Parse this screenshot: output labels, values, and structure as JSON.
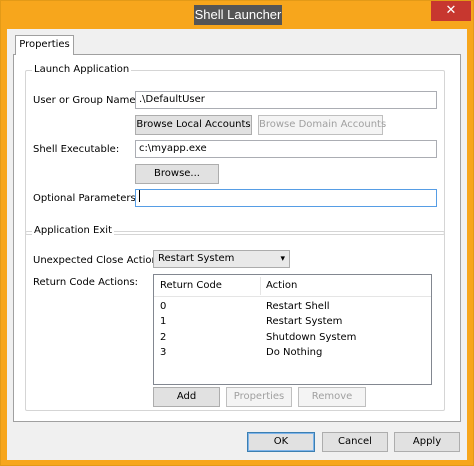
{
  "window": {
    "title": "Shell Launcher",
    "close_glyph": "✕"
  },
  "tabs": [
    {
      "label": "Properties"
    }
  ],
  "launch_group": {
    "title": "Launch Application",
    "user_label": "User or Group Name:",
    "user_value": ".\\DefaultUser",
    "browse_local_label": "Browse Local Accounts",
    "browse_domain_label": "Browse Domain Accounts",
    "shell_label": "Shell Executable:",
    "shell_value": "c:\\myapp.exe",
    "browse_label": "Browse...",
    "params_label": "Optional Parameters:",
    "params_value": ""
  },
  "exit_group": {
    "title": "Application Exit",
    "close_action_label": "Unexpected Close Action:",
    "close_action_value": "Restart System",
    "return_codes_label": "Return Code Actions:",
    "columns": [
      "Return Code",
      "Action"
    ],
    "rows": [
      {
        "code": "0",
        "action": "Restart Shell"
      },
      {
        "code": "1",
        "action": "Restart System"
      },
      {
        "code": "2",
        "action": "Shutdown System"
      },
      {
        "code": "3",
        "action": "Do Nothing"
      }
    ],
    "add_label": "Add",
    "properties_label": "Properties",
    "remove_label": "Remove"
  },
  "footer": {
    "ok_label": "OK",
    "cancel_label": "Cancel",
    "apply_label": "Apply"
  },
  "colors": {
    "title_bg": "#f7a61c",
    "close_bg": "#c7372f",
    "focus_border": "#569de5"
  },
  "icons": {
    "dropdown": "chevron-down-icon",
    "close": "close-icon"
  }
}
